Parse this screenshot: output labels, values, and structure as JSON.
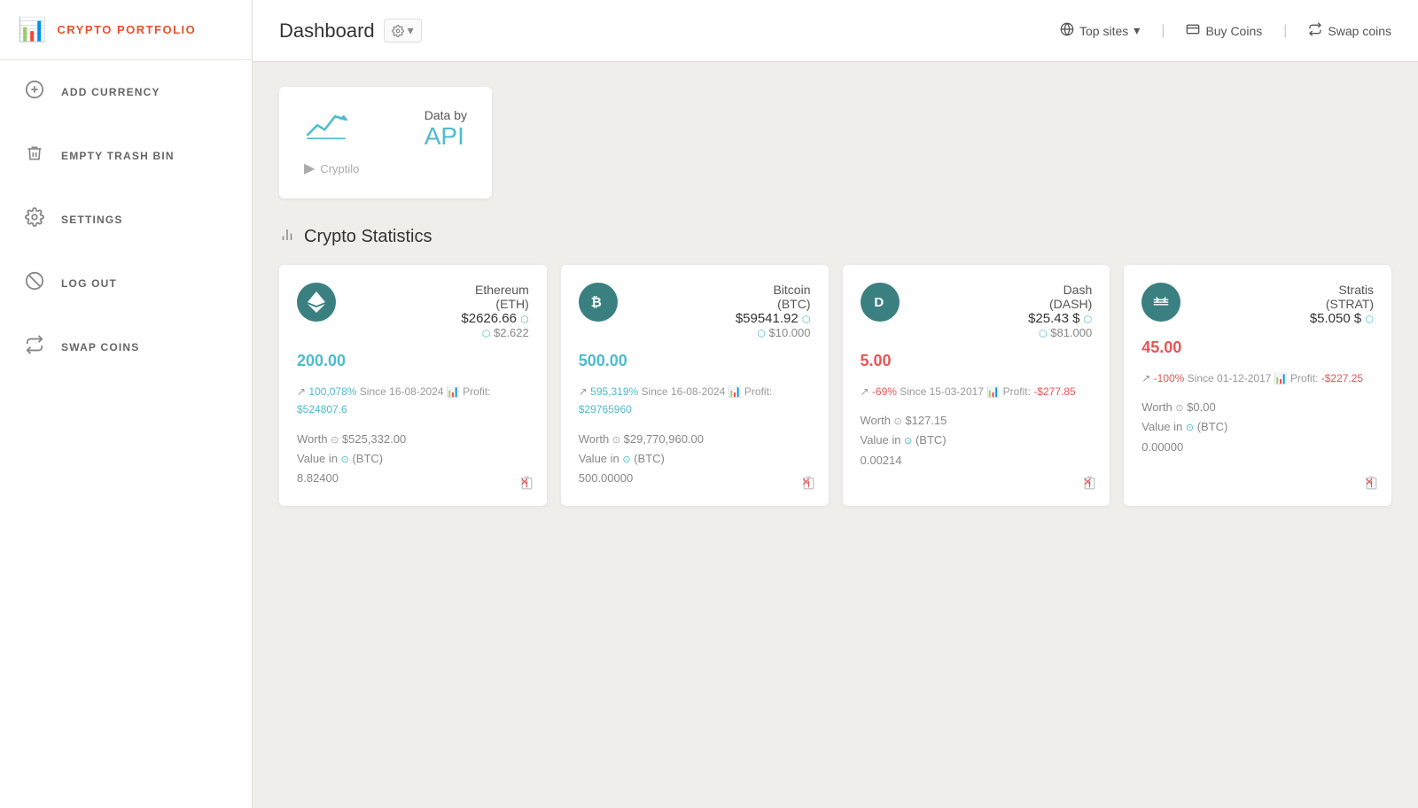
{
  "app": {
    "name": "CRYPTO PORTFOLIO"
  },
  "sidebar": {
    "items": [
      {
        "id": "add-currency",
        "label": "ADD CURRENCY",
        "icon": "₿"
      },
      {
        "id": "empty-trash",
        "label": "EMPTY TRASH BIN",
        "icon": "🗑"
      },
      {
        "id": "settings",
        "label": "SETTINGS",
        "icon": "⚙"
      },
      {
        "id": "log-out",
        "label": "LOG OUT",
        "icon": "⊘"
      },
      {
        "id": "swap-coins",
        "label": "SWAP COINS",
        "icon": "⟳"
      }
    ]
  },
  "header": {
    "title": "Dashboard",
    "settings_btn": "⚙ ▾",
    "nav": [
      {
        "id": "top-sites",
        "label": "Top sites",
        "icon": "🌐",
        "has_arrow": true
      },
      {
        "id": "buy-coins",
        "label": "Buy Coins",
        "icon": "💳"
      },
      {
        "id": "swap-coins",
        "label": "Swap coins",
        "icon": "↔"
      }
    ]
  },
  "api_card": {
    "data_label": "Data by",
    "api_value": "API",
    "provider": "Cryptilo"
  },
  "section": {
    "title": "Crypto Statistics"
  },
  "coins": [
    {
      "id": "eth",
      "name": "Ethereum",
      "ticker": "ETH",
      "icon_text": "♦",
      "amount": "200.00",
      "price_usd": "$2626.66",
      "price_btc": "$2.622",
      "percent": "100,078%",
      "since": "Since 16-08-2024",
      "profit": "$524807.6",
      "profit_positive": true,
      "worth": "$525,332.00",
      "value_btc": "8.82400"
    },
    {
      "id": "btc",
      "name": "Bitcoin",
      "ticker": "BTC",
      "icon_text": "₿",
      "amount": "500.00",
      "price_usd": "$59541.92",
      "price_btc": "$10.000",
      "percent": "595,319%",
      "since": "Since 16-08-2024",
      "profit": "$29765960",
      "profit_positive": true,
      "worth": "$29,770,960.00",
      "value_btc": "500.00000"
    },
    {
      "id": "dash",
      "name": "Dash",
      "ticker": "DASH",
      "icon_text": "D",
      "amount": "5.00",
      "price_usd": "$25.43",
      "price_btc": "$81.000",
      "percent": "-69%",
      "since": "Since 15-03-2017",
      "profit": "-$277.85",
      "profit_positive": false,
      "worth": "$127.15",
      "value_btc": "0.00214"
    },
    {
      "id": "strat",
      "name": "Stratis",
      "ticker": "STRAT",
      "icon_text": "≡",
      "amount": "45.00",
      "price_usd": "$5.050",
      "price_btc": "",
      "percent": "-100%",
      "since": "Since 01-12-2017",
      "profit": "-$227.25",
      "profit_positive": false,
      "worth": "$0.00",
      "value_btc": "0.00000"
    }
  ]
}
